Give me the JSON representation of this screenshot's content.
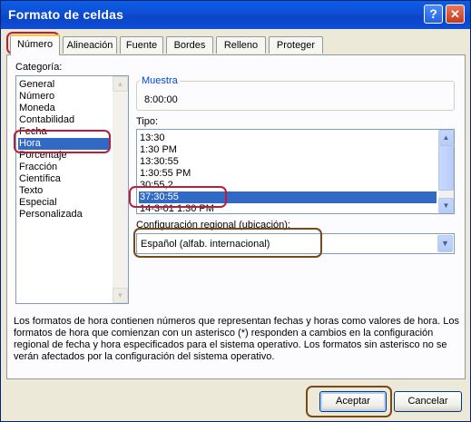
{
  "window": {
    "title": "Formato de celdas",
    "help_glyph": "?",
    "close_glyph": "✕"
  },
  "tabs": [
    {
      "label": "Número"
    },
    {
      "label": "Alineación"
    },
    {
      "label": "Fuente"
    },
    {
      "label": "Bordes"
    },
    {
      "label": "Relleno"
    },
    {
      "label": "Proteger"
    }
  ],
  "category": {
    "label": "Categoría:",
    "items": [
      "General",
      "Número",
      "Moneda",
      "Contabilidad",
      "Fecha",
      "Hora",
      "Porcentaje",
      "Fracción",
      "Científica",
      "Texto",
      "Especial",
      "Personalizada"
    ],
    "selected": "Hora"
  },
  "sample": {
    "label": "Muestra",
    "value": "8:00:00"
  },
  "type": {
    "label": "Tipo:",
    "items": [
      "13:30",
      "1:30 PM",
      "13:30:55",
      "1:30:55 PM",
      "30:55,2",
      "37:30:55",
      "14-3-01 1:30 PM"
    ],
    "selected": "37:30:55"
  },
  "locale": {
    "label": "Configuración regional (ubicación):",
    "value": "Español (alfab. internacional)"
  },
  "description": "Los formatos de hora contienen números que representan fechas y horas como valores de hora. Los formatos de hora que comienzan con un asterisco (*) responden a cambios en la configuración regional de fecha y hora especificados para el sistema operativo. Los formatos sin asterisco no se verán afectados por la configuración del sistema operativo.",
  "buttons": {
    "ok": "Aceptar",
    "cancel": "Cancelar"
  },
  "colors": {
    "titlebar": "#0b4fd6",
    "selection": "#316ac5",
    "highlight_red": "#b7203a",
    "highlight_brown": "#7a4a16",
    "group_title": "#0046d5"
  }
}
